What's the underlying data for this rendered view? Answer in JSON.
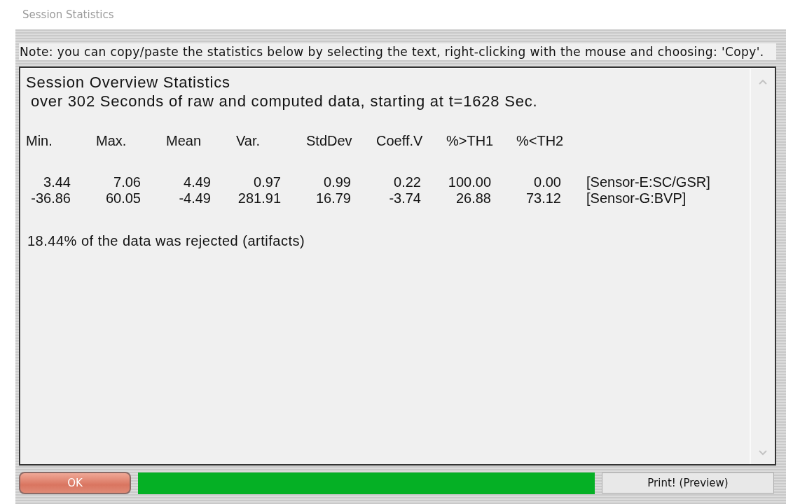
{
  "window": {
    "title": "Session Statistics"
  },
  "note": "Note: you can copy/paste the statistics below by selecting the text, right-clicking with the mouse and choosing: 'Copy'.",
  "report": {
    "heading": "Session Overview Statistics",
    "subheading": " over 302 Seconds of raw and computed data, starting at t=1628 Sec.",
    "columns": [
      "Min.",
      "Max.",
      "Mean",
      "Var.",
      "StdDev",
      "Coeff.V",
      "%>TH1",
      "%<TH2"
    ],
    "rows": [
      {
        "values": [
          "3.44",
          "7.06",
          "4.49",
          "0.97",
          "0.99",
          "0.22",
          "100.00",
          "0.00"
        ],
        "sensor": "[Sensor-E:SC/GSR]"
      },
      {
        "values": [
          "-36.86",
          "60.05",
          "-4.49",
          "281.91",
          "16.79",
          "-3.74",
          "26.88",
          "73.12"
        ],
        "sensor": "[Sensor-G:BVP]"
      }
    ],
    "footer": "18.44% of the data was rejected (artifacts)"
  },
  "ok_button": "OK",
  "progress": {
    "level": 1
  },
  "print_button": "Print! (Preview)"
}
